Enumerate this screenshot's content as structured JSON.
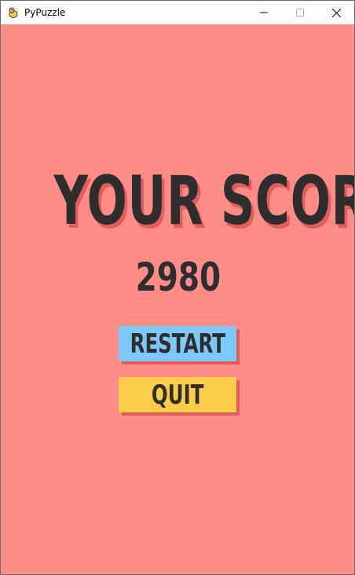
{
  "window": {
    "title": "PyPuzzle",
    "app_icon": "pygame-snake-icon",
    "controls": [
      "minimize-icon",
      "maximize-icon",
      "close-icon"
    ]
  },
  "game_over": {
    "heading": "YOUR SCORE",
    "score": "2980",
    "restart_label": "RESTART",
    "quit_label": "QUIT"
  },
  "colors": {
    "background": "#ff8c86",
    "text": "#2e2e2e",
    "shadow": "#e25c5c",
    "restart_button": "#7cc8f9",
    "quit_button": "#fdcc48"
  }
}
